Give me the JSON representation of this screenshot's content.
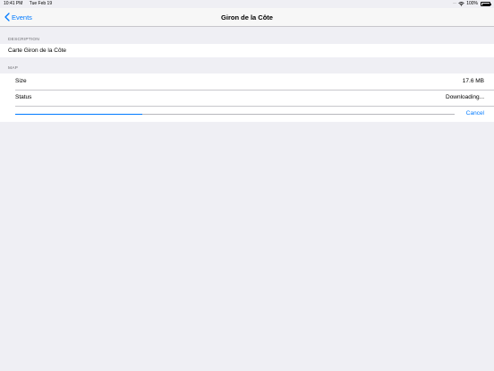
{
  "status_bar": {
    "time": "10:41 PM",
    "date": "Tue Feb 19",
    "battery_pct": "100%"
  },
  "nav": {
    "back_label": "Events",
    "title": "Giron de la Côte"
  },
  "description": {
    "header": "DESCRIPTION",
    "text": "Carte Giron de la Côte"
  },
  "map": {
    "header": "MAP",
    "size_label": "Size",
    "size_value": "17.6  MB",
    "status_label": "Status",
    "status_value": "Downloading...",
    "progress": 0.29,
    "cancel_label": "Cancel"
  },
  "colors": {
    "accent": "#007aff",
    "background": "#efeff4"
  }
}
